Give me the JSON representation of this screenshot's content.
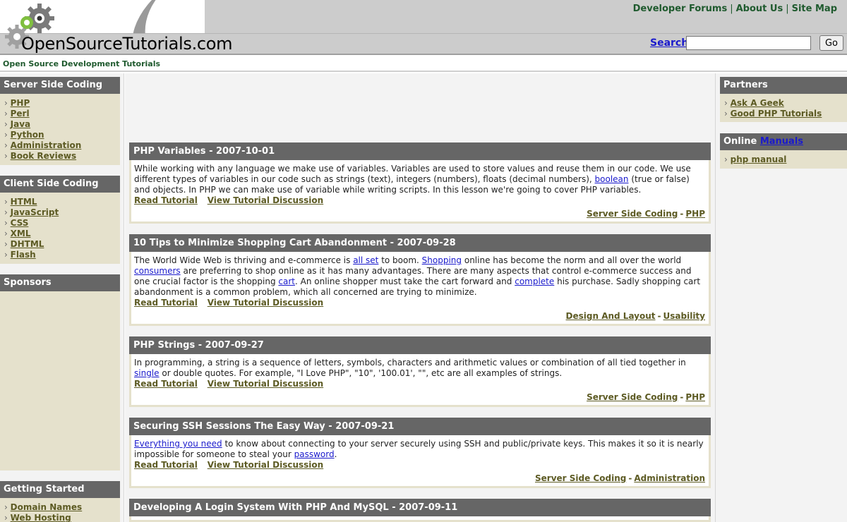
{
  "header": {
    "site_title": "OpenSourceTutorials.com",
    "tagline": "Open Source Development Tutorials",
    "top_links": [
      "Developer Forums",
      "About Us",
      "Site Map"
    ],
    "search_label": "Search",
    "search_value": "",
    "go_label": "Go"
  },
  "left_sidebar": {
    "server_side": {
      "title": "Server Side Coding",
      "items": [
        "PHP",
        "Perl",
        "Java",
        "Python",
        "Administration",
        "Book Reviews"
      ]
    },
    "client_side": {
      "title": "Client Side Coding",
      "items": [
        "HTML",
        "JavaScript",
        "CSS",
        "XML",
        "DHTML",
        "Flash"
      ]
    },
    "sponsors": {
      "title": "Sponsors"
    },
    "getting_started": {
      "title": "Getting Started",
      "items": [
        "Domain Names",
        "Web Hosting"
      ]
    }
  },
  "right_sidebar": {
    "partners": {
      "title": "Partners",
      "items": [
        "Ask A Geek",
        "Good PHP Tutorials"
      ]
    },
    "online_manuals": {
      "title_prefix": "Online",
      "title_link": "Manuals",
      "items": [
        "php manual"
      ]
    }
  },
  "posts": [
    {
      "title": "PHP Variables - 2007-10-01",
      "text_parts": [
        "While working with any language we make use of variables. Variables are used to store values and reuse them in our code. We use different types of variables in our code such as strings (text), integers (numbers), floats (decimal numbers), ",
        "boolean",
        " (true or false) and objects. In PHP we can make use of variable while writing scripts. In this lesson we're going to cover PHP variables."
      ],
      "read_label": "Read Tutorial",
      "discussion_label": "View Tutorial Discussion",
      "categories": [
        "Server Side Coding",
        "PHP"
      ]
    },
    {
      "title": "10 Tips to Minimize Shopping Cart Abandonment - 2007-09-28",
      "text_parts": [
        "The World Wide Web is thriving and e-commerce is ",
        "all set",
        " to boom. ",
        "Shopping",
        " online has become the norm and all over the world ",
        "consumers",
        " are preferring to shop online as it has many advantages. There are many aspects that control e-commerce success and one crucial factor is the shopping ",
        "cart",
        ". An online shopper must take the cart forward and ",
        "complete",
        " his purchase. Sadly shopping cart abandonment is a common problem, which all concerned are trying to minimize."
      ],
      "read_label": "Read Tutorial",
      "discussion_label": "View Tutorial Discussion",
      "categories": [
        "Design And Layout",
        "Usability"
      ]
    },
    {
      "title": "PHP Strings - 2007-09-27",
      "text_parts": [
        "In programming, a string is a sequence of letters, symbols, characters and arithmetic values or combination of all tied together in ",
        "single",
        " or double quotes. For example, \"I Love PHP\", \"10\", '100.01', \"\", etc are all examples of strings."
      ],
      "read_label": "Read Tutorial",
      "discussion_label": "View Tutorial Discussion",
      "categories": [
        "Server Side Coding",
        "PHP"
      ]
    },
    {
      "title": "Securing SSH Sessions The Easy Way - 2007-09-21",
      "text_parts": [
        "Everything you need",
        " to know about connecting to your server securely using SSH and public/private keys. This makes it so it is nearly impossible for someone to steal your ",
        "password",
        "."
      ],
      "read_label": "Read Tutorial",
      "discussion_label": "View Tutorial Discussion",
      "categories": [
        "Server Side Coding",
        "Administration"
      ]
    },
    {
      "title": "Developing A Login System With PHP And MySQL - 2007-09-11"
    }
  ],
  "colors": {
    "header_gray": "#cccccc",
    "box_title_bg": "#666666",
    "box_body_bg": "#e5e1cc",
    "link_olive": "#5d5b24",
    "link_blue": "#1a1acc",
    "green_text": "#1f5a2e"
  }
}
